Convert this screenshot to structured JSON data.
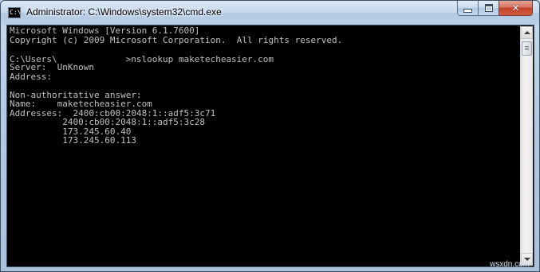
{
  "window": {
    "title": "Administrator: C:\\Windows\\system32\\cmd.exe",
    "icon_label": "C:\\",
    "icon": "cmd-app-icon",
    "buttons": {
      "minimize_icon": "minimize-icon",
      "maximize_icon": "maximize-icon",
      "close_icon": "close-icon",
      "close_glyph": "✕"
    }
  },
  "console": {
    "text_color": "#c0c0c0",
    "background": "#000000",
    "lines": [
      "Microsoft Windows [Version 6.1.7600]",
      "Copyright (c) 2009 Microsoft Corporation.  All rights reserved.",
      "",
      "C:\\Users\\",
      "Server:  UnKnown",
      "Address:",
      "",
      "Non-authoritative answer:",
      "Name:    maketecheasier.com",
      "Addresses:  2400:cb00:2048:1::adf5:3c71",
      "          2400:cb00:2048:1::adf5:3c28",
      "          173.245.60.40",
      "          173.245.60.113"
    ],
    "prompt_command": ">nslookup maketecheasier.com"
  },
  "watermark": "wsxdn.com",
  "colors": {
    "titlebar": "#c4d7ec",
    "close_button": "#c2432c",
    "frame": "#b4cbe2"
  }
}
